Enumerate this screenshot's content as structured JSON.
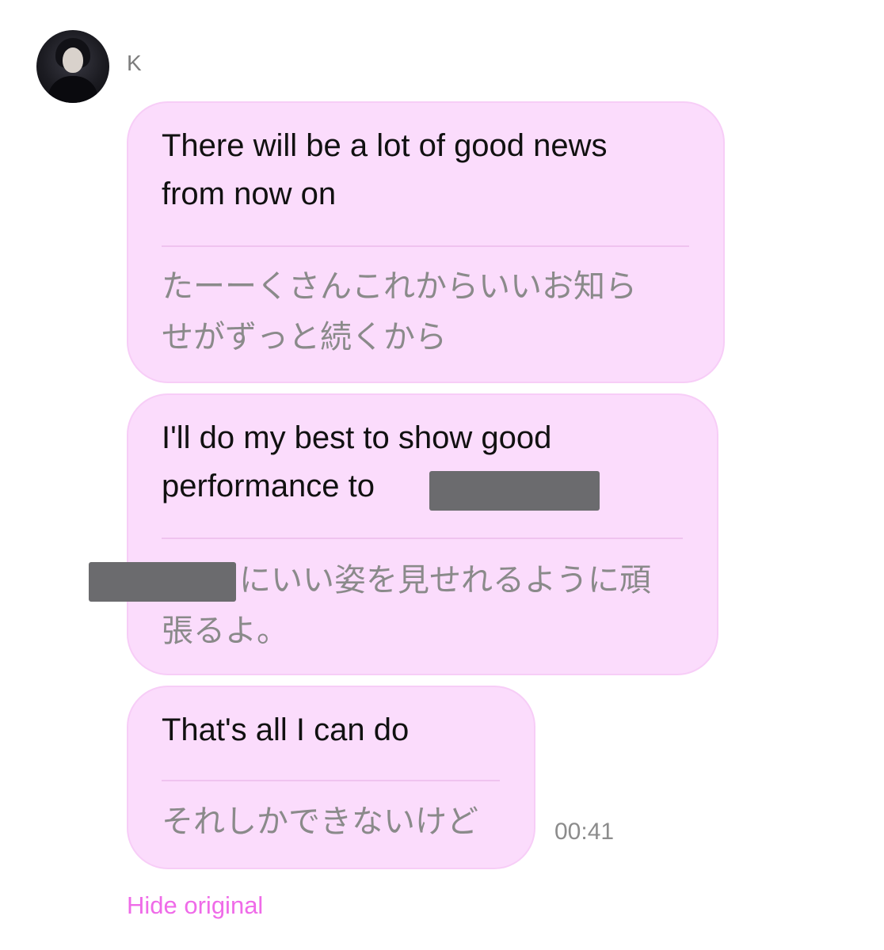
{
  "sender": {
    "name": "K",
    "avatar_icon": "user-avatar"
  },
  "messages": [
    {
      "original": "There will be a lot of good news\nfrom now on",
      "translation": "たーーくさんこれからいいお知ら\nせがずっと続くから"
    },
    {
      "original_before_redaction": "I'll do my best to show good\nperformance to",
      "translation_after_redaction": "にいい姿を見せれるように頑\n張るよ。"
    },
    {
      "original": "That's all I can do",
      "translation": "それしかできないけど",
      "time": "00:41"
    }
  ],
  "footer": {
    "hide_original_label": "Hide original"
  },
  "colors": {
    "bubble_bg": "#fbdcfc",
    "link": "#ef6be8",
    "redaction": "#6b6b6e"
  }
}
